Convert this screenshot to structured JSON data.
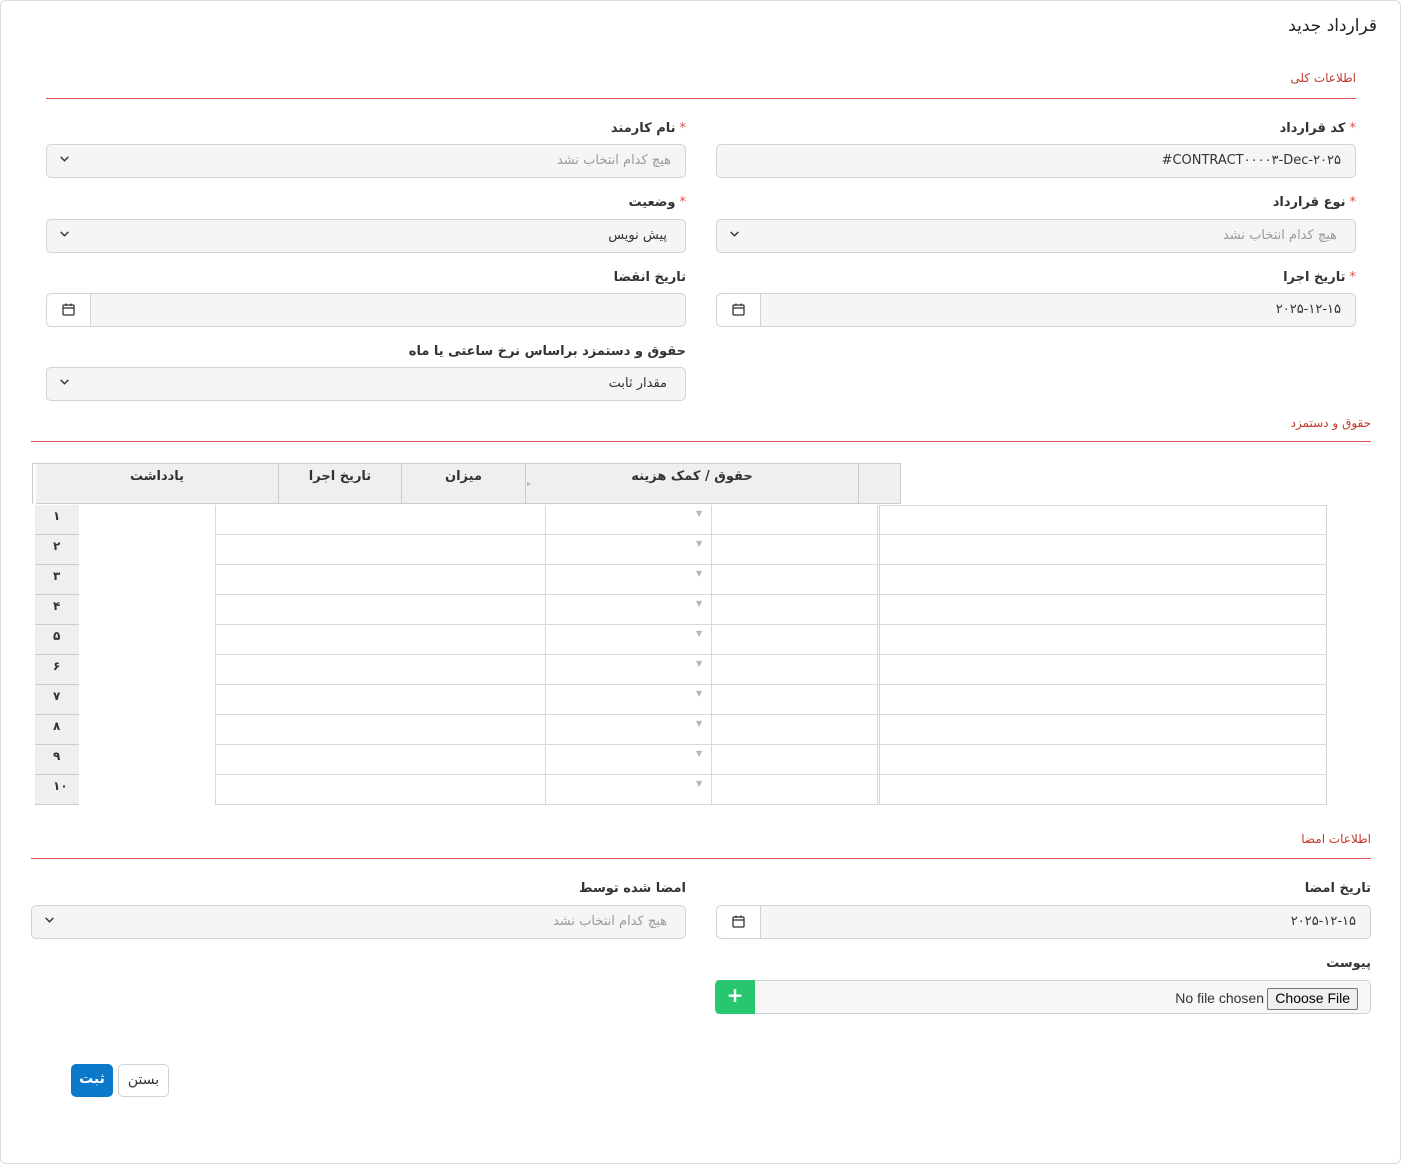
{
  "page_title": "قرارداد جدید",
  "sections": {
    "general": "اطلاعات کلی",
    "salary": "حقوق و دستمزد",
    "signature": "اطلاعات امضا"
  },
  "fields": {
    "contract_code": {
      "label": "کد قرارداد",
      "value": "#CONTRACT۰۰۰۰۳-Dec-۲۰۲۵"
    },
    "employee_name": {
      "label": "نام کارمند",
      "placeholder": "هیچ کدام انتخاب نشد"
    },
    "contract_type": {
      "label": "نوع قرارداد",
      "placeholder": "هیچ کدام انتخاب نشد"
    },
    "status": {
      "label": "وضعیت",
      "value": "پیش نویس"
    },
    "start_date": {
      "label": "تاریخ اجرا",
      "value": "۲۰۲۵-۱۲-۱۵"
    },
    "end_date": {
      "label": "تاریخ انقضا",
      "value": ""
    },
    "salary_basis": {
      "label": "حقوق و دستمزد براساس نرخ ساعتی یا ماه",
      "value": "مقدار ثابت"
    },
    "sign_date": {
      "label": "تاریخ امضا",
      "value": "۲۰۲۵-۱۲-۱۵"
    },
    "signed_by": {
      "label": "امضا شده توسط",
      "placeholder": "هیچ کدام انتخاب نشد"
    },
    "attachment": {
      "label": "پیوست",
      "choose_label": "Choose File",
      "status": "No file chosen",
      "add": "+"
    }
  },
  "grid": {
    "columns": [
      "حقوق / کمک هزینه",
      "میزان",
      "تاریخ اجرا",
      "یادداشت"
    ],
    "rows": [
      "۱",
      "۲",
      "۳",
      "۴",
      "۵",
      "۶",
      "۷",
      "۸",
      "۹",
      "۱۰"
    ]
  },
  "buttons": {
    "submit": "ثبت",
    "close": "بستن"
  },
  "colors": {
    "accent": "#d9534f",
    "primary": "#0b79c9",
    "success": "#28c76f"
  }
}
